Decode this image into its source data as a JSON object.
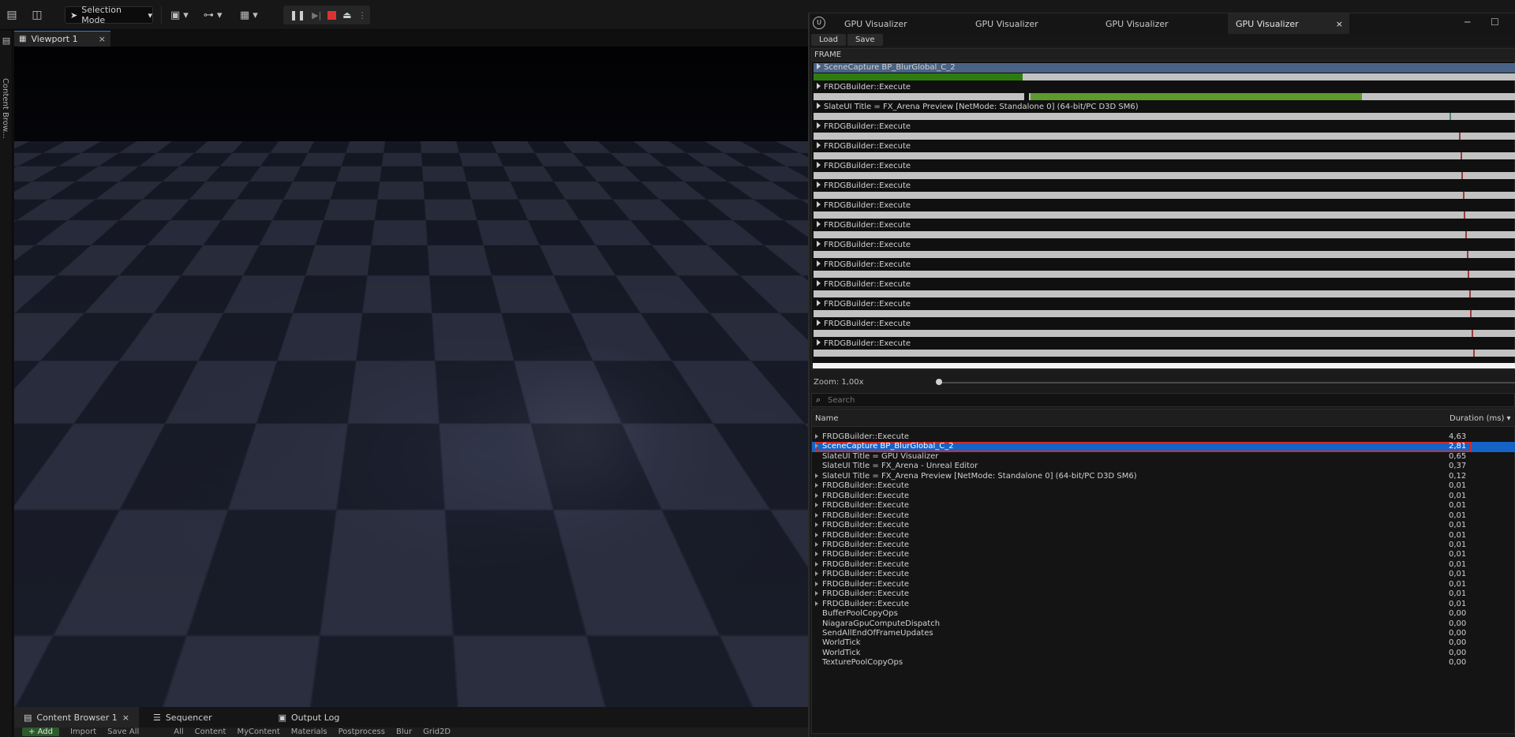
{
  "toolbar": {
    "mode_label": "Selection Mode"
  },
  "left_strip": {
    "label": "Content Brow..."
  },
  "viewport": {
    "tab_label": "Viewport 1",
    "close": "×"
  },
  "bottom": {
    "tabs": [
      {
        "label": "Content Browser 1"
      },
      {
        "label": "Sequencer"
      },
      {
        "label": "Output Log"
      }
    ],
    "close": "×",
    "bar": {
      "add": "Add",
      "import": "Import",
      "save_all": "Save All",
      "path": [
        "All",
        "Content",
        "MyContent",
        "Materials",
        "Postprocess",
        "Blur",
        "Grid2D"
      ]
    }
  },
  "gpu": {
    "tabs": [
      "GPU Visualizer",
      "GPU Visualizer",
      "GPU Visualizer",
      "GPU Visualizer"
    ],
    "tab_close": "×",
    "load": "Load",
    "save": "Save",
    "frame_header": "FRAME",
    "frame_rows": [
      "SceneCapture BP_BlurGlobal_C_2",
      "FRDGBuilder::Execute",
      "SlateUI Title = FX_Arena Preview [NetMode: Standalone 0]  (64-bit/PC D3D SM6)",
      "FRDGBuilder::Execute",
      "FRDGBuilder::Execute",
      "FRDGBuilder::Execute",
      "FRDGBuilder::Execute",
      "FRDGBuilder::Execute",
      "FRDGBuilder::Execute",
      "FRDGBuilder::Execute",
      "FRDGBuilder::Execute",
      "FRDGBuilder::Execute",
      "FRDGBuilder::Execute",
      "FRDGBuilder::Execute",
      "FRDGBuilder::Execute"
    ],
    "zoom_label": "Zoom: 1,00x",
    "search_placeholder": "Search",
    "list_header": {
      "name": "Name",
      "duration": "Duration (ms) ▾"
    },
    "list": [
      {
        "name": "FRDGBuilder::Execute",
        "dur": "4,63",
        "arrow": true
      },
      {
        "name": "SceneCapture BP_BlurGlobal_C_2",
        "dur": "2,81",
        "arrow": true,
        "selected": true
      },
      {
        "name": "SlateUI Title = GPU Visualizer",
        "dur": "0,65",
        "arrow": false
      },
      {
        "name": "SlateUI Title = FX_Arena - Unreal Editor",
        "dur": "0,37",
        "arrow": false
      },
      {
        "name": "SlateUI Title = FX_Arena Preview [NetMode: Standalone 0]  (64-bit/PC D3D SM6)",
        "dur": "0,12",
        "arrow": true
      },
      {
        "name": "FRDGBuilder::Execute",
        "dur": "0,01",
        "arrow": true
      },
      {
        "name": "FRDGBuilder::Execute",
        "dur": "0,01",
        "arrow": true
      },
      {
        "name": "FRDGBuilder::Execute",
        "dur": "0,01",
        "arrow": true
      },
      {
        "name": "FRDGBuilder::Execute",
        "dur": "0,01",
        "arrow": true
      },
      {
        "name": "FRDGBuilder::Execute",
        "dur": "0,01",
        "arrow": true
      },
      {
        "name": "FRDGBuilder::Execute",
        "dur": "0,01",
        "arrow": true
      },
      {
        "name": "FRDGBuilder::Execute",
        "dur": "0,01",
        "arrow": true
      },
      {
        "name": "FRDGBuilder::Execute",
        "dur": "0,01",
        "arrow": true
      },
      {
        "name": "FRDGBuilder::Execute",
        "dur": "0,01",
        "arrow": true
      },
      {
        "name": "FRDGBuilder::Execute",
        "dur": "0,01",
        "arrow": true
      },
      {
        "name": "FRDGBuilder::Execute",
        "dur": "0,01",
        "arrow": true
      },
      {
        "name": "FRDGBuilder::Execute",
        "dur": "0,01",
        "arrow": true
      },
      {
        "name": "FRDGBuilder::Execute",
        "dur": "0,01",
        "arrow": true
      },
      {
        "name": "BufferPoolCopyOps",
        "dur": "0,00",
        "arrow": false
      },
      {
        "name": "NiagaraGpuComputeDispatch",
        "dur": "0,00",
        "arrow": false
      },
      {
        "name": "SendAllEndOfFrameUpdates",
        "dur": "0,00",
        "arrow": false
      },
      {
        "name": "WorldTick",
        "dur": "0,00",
        "arrow": false
      },
      {
        "name": "WorldTick",
        "dur": "0,00",
        "arrow": false
      },
      {
        "name": "TexturePoolCopyOps",
        "dur": "0,00",
        "arrow": false
      }
    ],
    "colors": {
      "selection": "#1663c7",
      "outline": "#d42a2a",
      "bar_green": "#2f7c0e",
      "bar_gray": "#c2c2c2"
    }
  }
}
